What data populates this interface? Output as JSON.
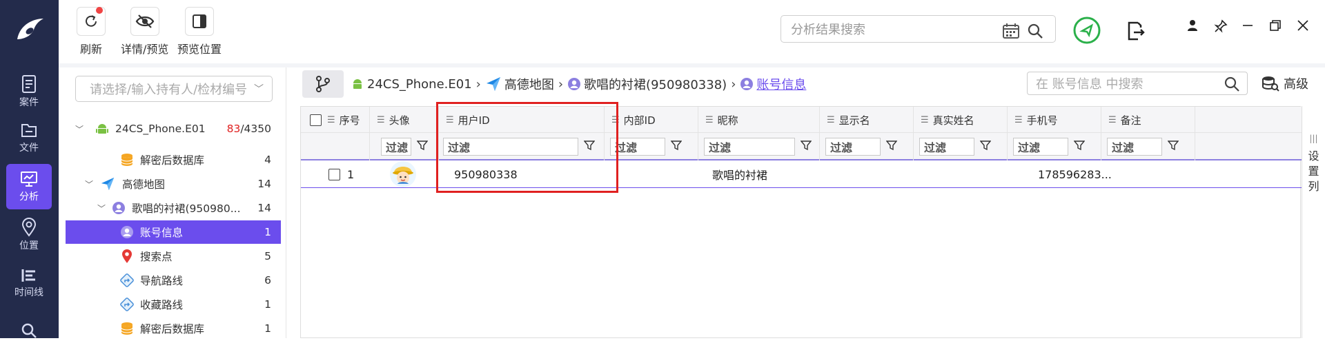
{
  "nav": {
    "items": [
      {
        "label": "案件",
        "icon": "case-icon"
      },
      {
        "label": "文件",
        "icon": "folder-icon"
      },
      {
        "label": "分析",
        "icon": "analysis-icon",
        "active": true
      },
      {
        "label": "位置",
        "icon": "location-pin-icon"
      },
      {
        "label": "时间线",
        "icon": "timeline-icon"
      },
      {
        "label": "",
        "icon": "search-icon"
      }
    ]
  },
  "toolbar": {
    "refresh": "刷新",
    "detail_preview": "详情/预览",
    "preview_position": "预览位置"
  },
  "global_search": {
    "placeholder": "分析结果搜索"
  },
  "left": {
    "select_placeholder": "请选择/输入持有人/检材编号"
  },
  "tree": [
    {
      "label": "24CS_Phone.E01",
      "count_red": "83",
      "count_total": "/4350"
    },
    {
      "label": "解密后数据库",
      "count": "4"
    },
    {
      "label": "高德地图",
      "count": "14"
    },
    {
      "label": "歌唱的衬裙(950980...",
      "count": "14"
    },
    {
      "label": "账号信息",
      "count": "1",
      "selected": true
    },
    {
      "label": "搜索点",
      "count": "5"
    },
    {
      "label": "导航路线",
      "count": "6"
    },
    {
      "label": "收藏路线",
      "count": "1"
    },
    {
      "label": "解密后数据库",
      "count": "1"
    }
  ],
  "breadcrumb": {
    "device": "24CS_Phone.E01",
    "app": "高德地图",
    "account": "歌唱的衬裙(950980338)",
    "current": "账号信息"
  },
  "table_search": {
    "placeholder": "在 账号信息 中搜索"
  },
  "advanced": "高级",
  "columns": [
    "序号",
    "头像",
    "用户ID",
    "内部ID",
    "昵称",
    "显示名",
    "真实姓名",
    "手机号",
    "备注"
  ],
  "filter_placeholder": "过滤",
  "rows": [
    {
      "index": "1",
      "user_id": "950980338",
      "internal_id": "",
      "nickname": "歌唱的衬裙",
      "display_name": "",
      "real_name": "",
      "phone": "178596283...",
      "note": ""
    }
  ],
  "settings_column": [
    "设",
    "置",
    "列"
  ],
  "colors": {
    "accent": "#6b4ded",
    "nav_bg": "#232b4b",
    "highlight": "#e02020",
    "green": "#2bb04a"
  }
}
